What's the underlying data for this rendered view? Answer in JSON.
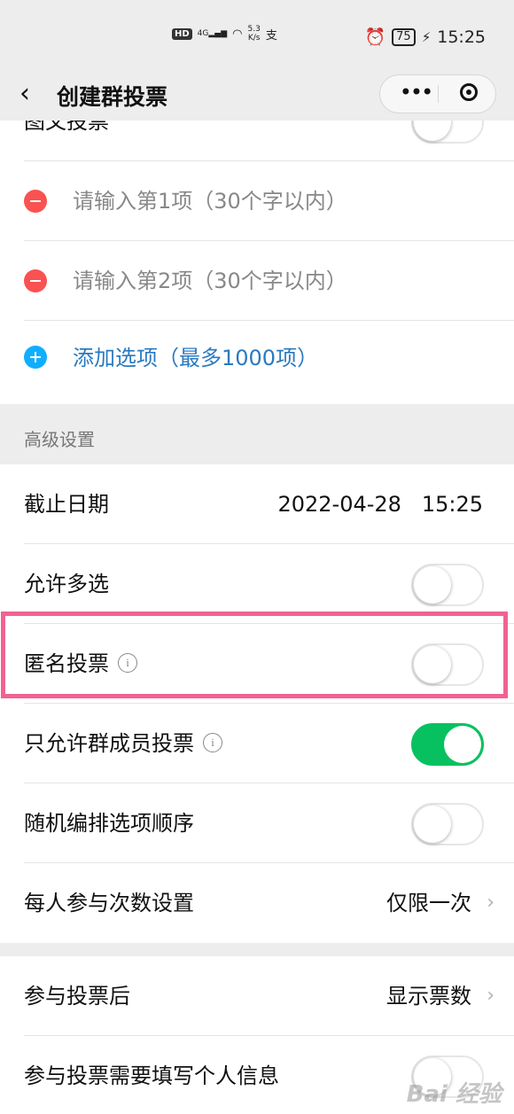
{
  "status_bar": {
    "hd": "HD",
    "network": "4G",
    "speed_value": "5.3",
    "speed_unit": "K/s",
    "battery": "75",
    "time": "15:25"
  },
  "nav": {
    "title": "创建群投票",
    "more_label": "•••"
  },
  "vote_options": {
    "image_text_label": "图文投票",
    "option1_placeholder": "请输入第1项（30个字以内）",
    "option2_placeholder": "请输入第2项（30个字以内）",
    "add_option_label": "添加选项（最多1000项）"
  },
  "advanced": {
    "section_title": "高级设置",
    "deadline_label": "截止日期",
    "deadline_value": "2022-04-28   15:25",
    "multi_select_label": "允许多选",
    "multi_select_on": false,
    "anonymous_label": "匿名投票",
    "anonymous_on": false,
    "members_only_label": "只允许群成员投票",
    "members_only_on": true,
    "random_order_label": "随机编排选项顺序",
    "random_order_on": false,
    "participation_label": "每人参与次数设置",
    "participation_value": "仅限一次"
  },
  "after_vote": {
    "label": "参与投票后",
    "value": "显示票数",
    "personal_info_label": "参与投票需要填写个人信息"
  },
  "icons": {
    "info": "i",
    "chevron": "›"
  },
  "colors": {
    "toggle_on": "#07c160",
    "remove": "#fa5151",
    "add": "#10aeff",
    "link": "#2a7ac1",
    "highlight": "#f06292"
  }
}
